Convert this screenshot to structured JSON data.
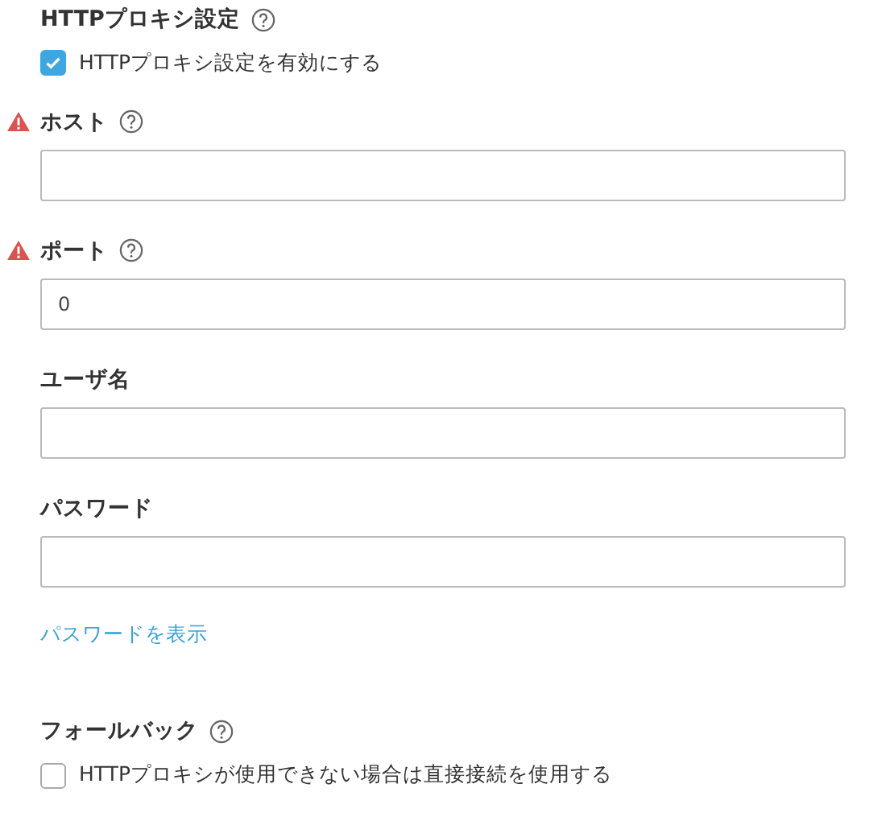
{
  "proxy_section": {
    "title": "HTTPプロキシ設定",
    "help": true,
    "enable_checkbox": {
      "label": "HTTPプロキシ設定を有効にする",
      "checked": true
    }
  },
  "fields": [
    {
      "label": "ホスト",
      "warning": true,
      "help": true
    },
    {
      "label": "ポート",
      "warning": true,
      "help": true,
      "value": "0"
    },
    {
      "label": "ユーザ名",
      "warning": false,
      "help": false
    },
    {
      "label": "パスワード",
      "warning": false,
      "help": false
    }
  ],
  "show_password_link": "パスワードを表示",
  "fallback_section": {
    "title": "フォールバック",
    "help": true,
    "checkbox": {
      "label": "HTTPプロキシが使用できない場合は直接接続を使用する",
      "checked": false
    }
  }
}
